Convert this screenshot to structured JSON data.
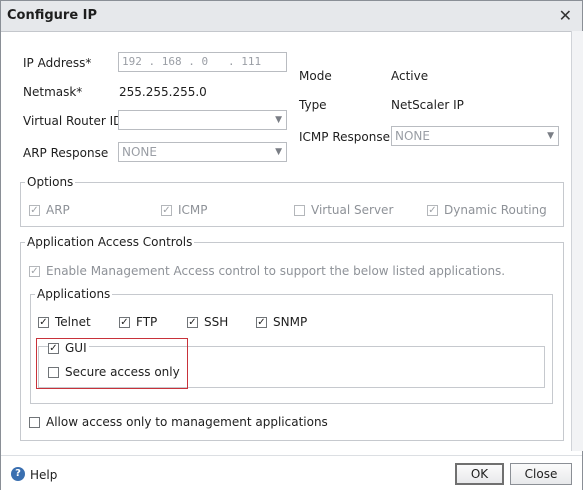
{
  "dialog": {
    "title": "Configure IP"
  },
  "fields": {
    "ip_label": "IP Address*",
    "ip_value": "192 . 168 . 0   . 111",
    "netmask_label": "Netmask*",
    "netmask_value": "255.255.255.0",
    "vrid_label": "Virtual Router ID",
    "vrid_value": "",
    "arp_label": "ARP Response",
    "arp_value": "NONE",
    "mode_label": "Mode",
    "mode_value": "Active",
    "type_label": "Type",
    "type_value": "NetScaler IP",
    "icmp_label": "ICMP Response",
    "icmp_value": "NONE"
  },
  "options": {
    "legend": "Options",
    "items": [
      {
        "label": "ARP",
        "checked": true,
        "disabled": true
      },
      {
        "label": "ICMP",
        "checked": true,
        "disabled": true
      },
      {
        "label": "Virtual Server",
        "checked": false,
        "disabled": true
      },
      {
        "label": "Dynamic Routing",
        "checked": true,
        "disabled": true
      }
    ]
  },
  "access_controls": {
    "legend": "Application Access Controls",
    "enable_label": "Enable Management Access control to support the below listed applications.",
    "enable_checked": true,
    "applications_legend": "Applications",
    "apps": [
      {
        "label": "Telnet",
        "checked": true
      },
      {
        "label": "FTP",
        "checked": true
      },
      {
        "label": "SSH",
        "checked": true
      },
      {
        "label": "SNMP",
        "checked": true
      }
    ],
    "gui_label": "GUI",
    "gui_checked": true,
    "secure_label": "Secure access only",
    "secure_checked": false,
    "allow_mgmt_label": "Allow access only to management applications",
    "allow_mgmt_checked": false
  },
  "footer": {
    "help_label": "Help",
    "ok_label": "OK",
    "close_label": "Close"
  },
  "icons": {
    "close": "close-icon",
    "help": "help-icon",
    "dropdown": "chevron-down-icon",
    "check": "check-icon"
  },
  "colors": {
    "highlight_border": "#c8323a",
    "help_icon": "#3a6fb0"
  }
}
